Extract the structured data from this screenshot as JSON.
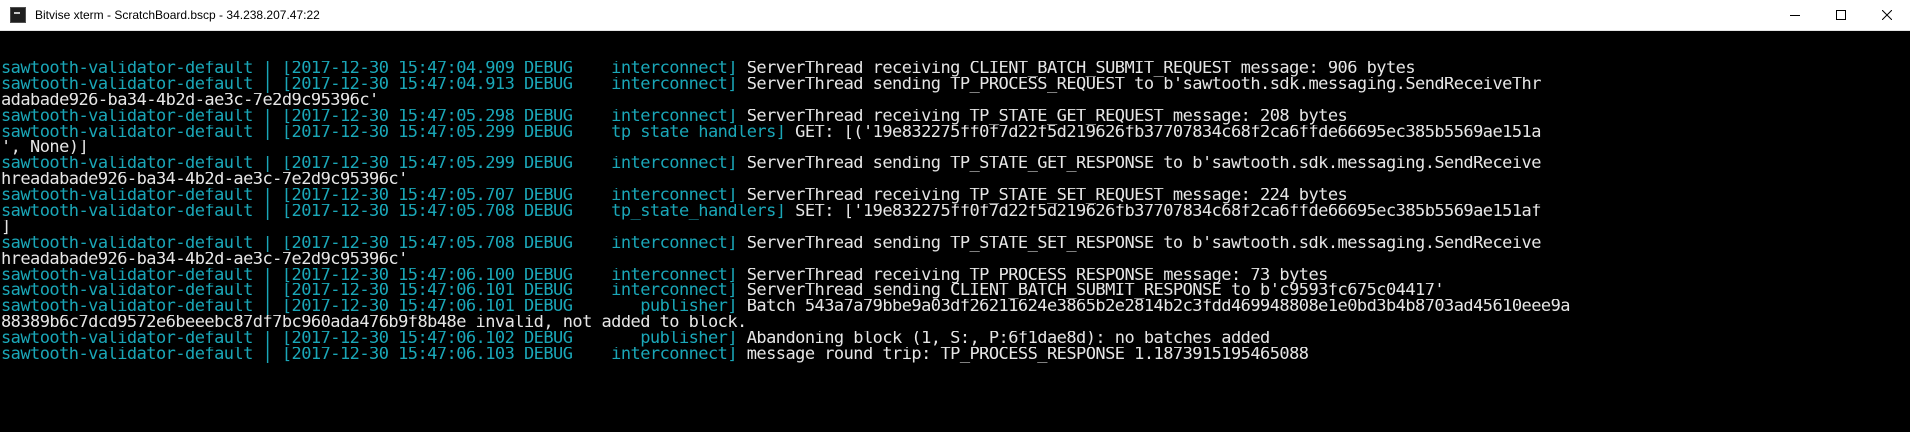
{
  "window": {
    "title": "Bitvise xterm - ScratchBoard.bscp - 34.238.207.47:22"
  },
  "controls": {
    "minimize": "minimize",
    "maximize": "maximize",
    "close": "close"
  },
  "colors": {
    "cyan": "#1aa7b8",
    "white": "#e6e6e6",
    "background": "#000000"
  },
  "lines": [
    {
      "p": "sawtooth-validator-default | [2017-12-30 15:47:04.909 DEBUG    interconnect] ",
      "m": "ServerThread receiving CLIENT_BATCH_SUBMIT_REQUEST message: 906 bytes"
    },
    {
      "p": "sawtooth-validator-default | [2017-12-30 15:47:04.913 DEBUG    interconnect] ",
      "m": "ServerThread sending TP_PROCESS_REQUEST to b'sawtooth.sdk.messaging.SendReceiveThr"
    },
    {
      "p": "",
      "m": "adabade926-ba34-4b2d-ae3c-7e2d9c95396c'"
    },
    {
      "p": "sawtooth-validator-default | [2017-12-30 15:47:05.298 DEBUG    interconnect] ",
      "m": "ServerThread receiving TP_STATE_GET_REQUEST message: 208 bytes"
    },
    {
      "p": "sawtooth-validator-default | [2017-12-30 15:47:05.299 DEBUG    tp_state_handlers] ",
      "m": "GET: [('19e832275ff0f7d22f5d219626fb37707834c68f2ca6ffde66695ec385b5569ae151a"
    },
    {
      "p": "",
      "m": "', None)]"
    },
    {
      "p": "sawtooth-validator-default | [2017-12-30 15:47:05.299 DEBUG    interconnect] ",
      "m": "ServerThread sending TP_STATE_GET_RESPONSE to b'sawtooth.sdk.messaging.SendReceive"
    },
    {
      "p": "",
      "m": "hreadabade926-ba34-4b2d-ae3c-7e2d9c95396c'"
    },
    {
      "p": "sawtooth-validator-default | [2017-12-30 15:47:05.707 DEBUG    interconnect] ",
      "m": "ServerThread receiving TP_STATE_SET_REQUEST message: 224 bytes"
    },
    {
      "p": "sawtooth-validator-default | [2017-12-30 15:47:05.708 DEBUG    tp_state_handlers] ",
      "m": "SET: ['19e832275ff0f7d22f5d219626fb37707834c68f2ca6ffde66695ec385b5569ae151af"
    },
    {
      "p": "",
      "m": "]"
    },
    {
      "p": "sawtooth-validator-default | [2017-12-30 15:47:05.708 DEBUG    interconnect] ",
      "m": "ServerThread sending TP_STATE_SET_RESPONSE to b'sawtooth.sdk.messaging.SendReceive"
    },
    {
      "p": "",
      "m": "hreadabade926-ba34-4b2d-ae3c-7e2d9c95396c'"
    },
    {
      "p": "sawtooth-validator-default | [2017-12-30 15:47:06.100 DEBUG    interconnect] ",
      "m": "ServerThread receiving TP_PROCESS_RESPONSE message: 73 bytes"
    },
    {
      "p": "sawtooth-validator-default | [2017-12-30 15:47:06.101 DEBUG    interconnect] ",
      "m": "ServerThread sending CLIENT_BATCH_SUBMIT_RESPONSE to b'c9593fc675c04417'"
    },
    {
      "p": "sawtooth-validator-default | [2017-12-30 15:47:06.101 DEBUG       publisher] ",
      "m": "Batch 543a7a79bbe9a03df26211624e3865b2e2814b2c3fdd469948808e1e0bd3b4b8703ad45610eee9a"
    },
    {
      "p": "",
      "m": "88389b6c7dcd9572e6beeebc87df7bc960ada476b9f8b48e invalid, not added to block."
    },
    {
      "p": "sawtooth-validator-default | [2017-12-30 15:47:06.102 DEBUG       publisher] ",
      "m": "Abandoning block (1, S:, P:6f1dae8d): no batches added"
    },
    {
      "p": "sawtooth-validator-default | [2017-12-30 15:47:06.103 DEBUG    interconnect] ",
      "m": "message round trip: TP_PROCESS_RESPONSE 1.1873915195465088"
    }
  ]
}
